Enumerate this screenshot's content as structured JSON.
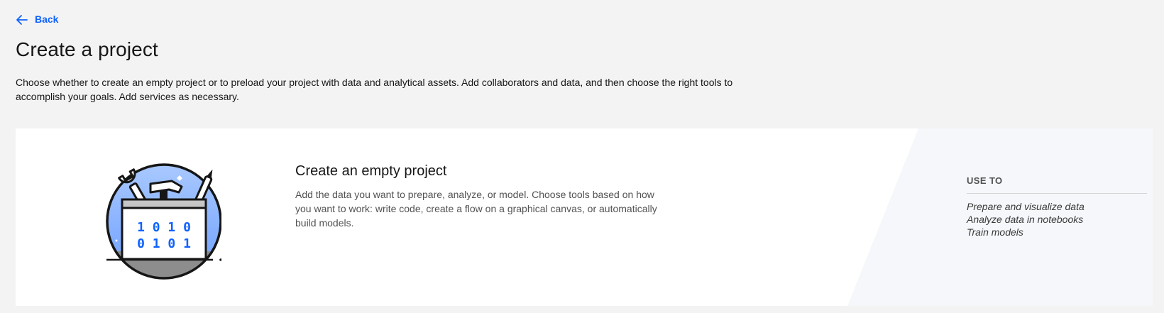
{
  "nav": {
    "back_label": "Back"
  },
  "page": {
    "title": "Create a project",
    "description": "Choose whether to create an empty project or to preload your project with data and analytical assets. Add collaborators and data, and then choose the right tools to accomplish your goals. Add services as necessary."
  },
  "card": {
    "title": "Create an empty project",
    "description": "Add the data you want to prepare, analyze, or model. Choose tools based on how you want to work: write code, create a flow on a graphical canvas, or automatically build models.",
    "illustration": {
      "icon": "toolbox-icon",
      "binary_row_1": "1 0 1 0",
      "binary_row_2": "0 1 0 1"
    },
    "use_to": {
      "heading": "USE TO",
      "items": [
        "Prepare and visualize data",
        "Analyze data in notebooks",
        "Train models"
      ]
    }
  },
  "colors": {
    "link": "#0f62fe",
    "background": "#f3f3f3",
    "card": "#ffffff",
    "card_aside": "#f5f7fa"
  }
}
